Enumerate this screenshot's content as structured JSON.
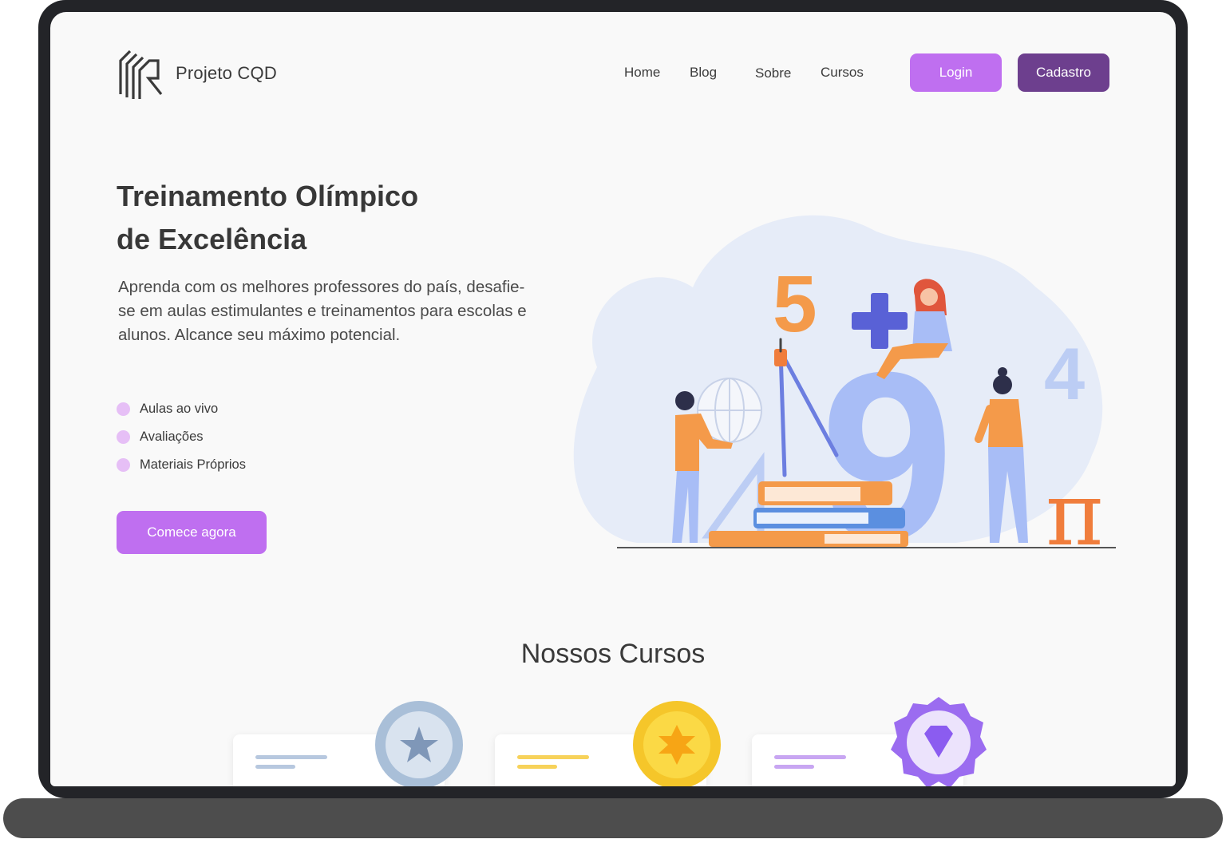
{
  "brand": {
    "name": "Projeto CQD"
  },
  "nav": [
    {
      "label": "Home"
    },
    {
      "label": "Blog"
    },
    {
      "label": "Sobre"
    },
    {
      "label": "Cursos"
    }
  ],
  "auth": {
    "login_label": "Login",
    "signup_label": "Cadastro"
  },
  "hero": {
    "title_line1": "Treinamento Olímpico",
    "title_line2": "de Excelência",
    "description": "Aprenda com os melhores professores do país, desafie-se em aulas estimulantes e treinamentos para escolas e alunos. Alcance seu máximo potencial.",
    "features": [
      "Aulas ao vivo",
      "Avaliações",
      "Materiais Próprios"
    ],
    "cta_label": "Comece agora",
    "illustration_numbers": [
      "5",
      "4",
      "9",
      "π"
    ]
  },
  "courses": {
    "title": "Nossos Cursos",
    "cards": [
      {
        "medal": "silver-star-medal-icon",
        "accent": "#b7c8df"
      },
      {
        "medal": "gold-star-medal-icon",
        "accent": "#f7d25a"
      },
      {
        "medal": "purple-diamond-badge-icon",
        "accent": "#c8a6f2"
      }
    ]
  },
  "colors": {
    "primary": "#bf6ff0",
    "primary_dark": "#6d3f8e",
    "feature_dot": "#e6bff6",
    "screen_bg": "#f9f9f9"
  }
}
